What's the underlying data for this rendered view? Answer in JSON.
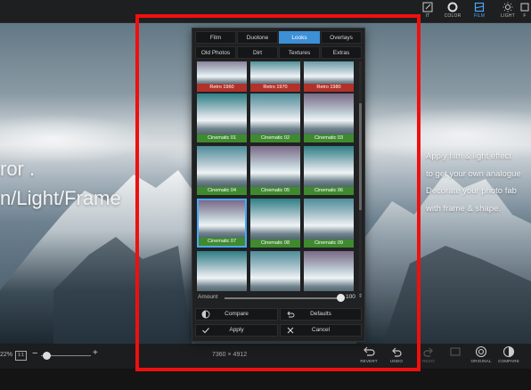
{
  "topbar": {
    "tools": [
      {
        "label": "IT",
        "icon": "edit-icon"
      },
      {
        "label": "COLOR",
        "icon": "color-circle-icon"
      },
      {
        "label": "FILM",
        "icon": "film-icon",
        "active": true
      },
      {
        "label": "LIGHT",
        "icon": "sun-icon"
      },
      {
        "label": "F",
        "icon": "frame-icon"
      }
    ]
  },
  "canvas": {
    "left_text_line1": "ror .",
    "left_text_line2": "n/Light/Frame",
    "right_text": [
      "Apply film & light effect",
      "to get your own analogue",
      "Decorate your photo fab",
      "with frame & shape."
    ]
  },
  "panel": {
    "tabs_row1": [
      {
        "label": "Film"
      },
      {
        "label": "Duotone"
      },
      {
        "label": "Looks",
        "active": true
      },
      {
        "label": "Overlays"
      }
    ],
    "tabs_row2": [
      {
        "label": "Old Photos"
      },
      {
        "label": "Dirt"
      },
      {
        "label": "Textures"
      },
      {
        "label": "Extras"
      }
    ],
    "thumbnails": [
      {
        "label": "Retro 1960",
        "color": "red"
      },
      {
        "label": "Retro 1970",
        "color": "red"
      },
      {
        "label": "Retro 1980",
        "color": "red"
      },
      {
        "label": "Cinematic 01",
        "color": "green"
      },
      {
        "label": "Cinematic 02",
        "color": "green"
      },
      {
        "label": "Cinematic 03",
        "color": "green"
      },
      {
        "label": "Cinematic 04",
        "color": "green"
      },
      {
        "label": "Cinematic 05",
        "color": "green"
      },
      {
        "label": "Cinematic 06",
        "color": "green"
      },
      {
        "label": "Cinematic 07",
        "color": "green",
        "selected": true
      },
      {
        "label": "Cinematic 08",
        "color": "green"
      },
      {
        "label": "Cinematic 09",
        "color": "green"
      },
      {
        "label": "",
        "color": "none"
      },
      {
        "label": "",
        "color": "none"
      },
      {
        "label": "",
        "color": "none"
      }
    ],
    "amount_label": "Amount",
    "amount_value": "100",
    "amount_level": 1.0,
    "compare_label": "Compare",
    "defaults_label": "Defaults",
    "apply_label": "Apply",
    "cancel_label": "Cancel"
  },
  "bottombar": {
    "zoom": "22%",
    "fit_label": "1:1",
    "dimensions": "7360 × 4912",
    "tools": [
      {
        "label": "REVERT",
        "icon": "revert-icon"
      },
      {
        "label": "UNDO",
        "icon": "undo-icon"
      },
      {
        "label": "REDO",
        "icon": "redo-icon",
        "dim": true
      },
      {
        "label": "",
        "icon": "history-icon",
        "dim": true
      },
      {
        "label": "ORIGINAL",
        "icon": "original-icon"
      },
      {
        "label": "COMPARE",
        "icon": "compare-icon"
      }
    ]
  },
  "colors": {
    "accent": "#3d8fd6",
    "label_green": "#3f8a2f",
    "label_red": "#b0322a",
    "highlight": "#f00f0f"
  }
}
